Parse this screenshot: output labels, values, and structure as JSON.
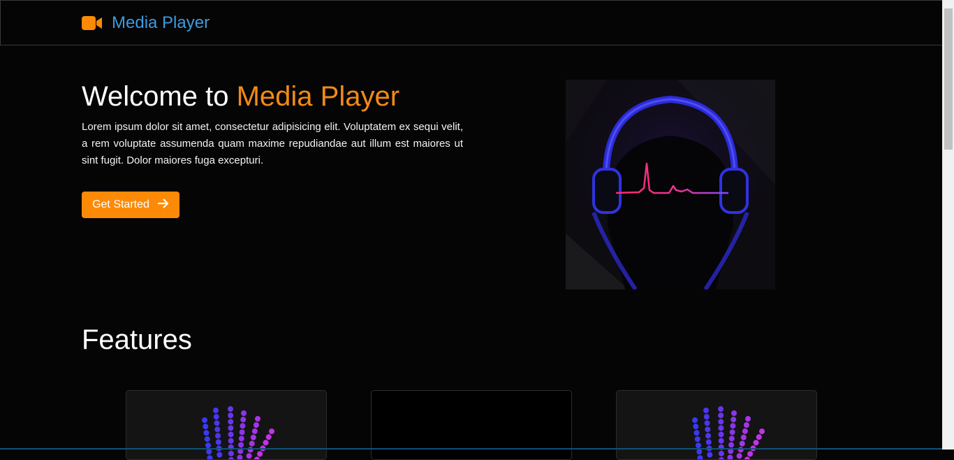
{
  "navbar": {
    "brand_icon": "video-camera-icon",
    "brand_title": "Media Player",
    "brand_color": "#3d9be0",
    "icon_color": "#fd8a06"
  },
  "hero": {
    "title_prefix": "Welcome to",
    "title_accent": "Media Player",
    "accent_color": "#f28a16",
    "description": "Lorem ipsum dolor sit amet, consectetur adipisicing elit. Voluptatem ex sequi velit, a rem voluptate assumenda quam maxime repudiandae aut illum est maiores ut sint fugit. Dolor maiores fuga excepturi.",
    "cta_label": "Get Started",
    "cta_icon": "arrow-right-icon",
    "cta_color": "#fd8a06",
    "image": "headphones-heartbeat-image"
  },
  "features": {
    "title": "Features",
    "cards": [
      {
        "image": "equalizer-bars-image"
      },
      {
        "image": "blank-video-image"
      },
      {
        "image": "equalizer-bars-image"
      }
    ]
  }
}
